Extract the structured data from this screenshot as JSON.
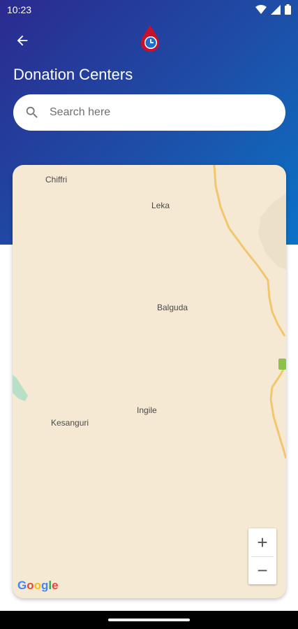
{
  "status_bar": {
    "time": "10:23"
  },
  "header": {
    "title": "Donation Centers",
    "back_icon": "arrow-left-icon",
    "logo_icon": "blood-drop-clock-logo"
  },
  "search": {
    "placeholder": "Search here",
    "value": ""
  },
  "map": {
    "places": [
      "Chiffri",
      "Leka",
      "Balguda",
      "Ingile",
      "Kesanguri"
    ],
    "zoom_in_label": "+",
    "zoom_out_label": "−",
    "attribution": "Google",
    "colors": {
      "land": "#f6e9d3",
      "road": "#f2c66d",
      "park": "#b8e0c6",
      "terrain": "#ede0c8"
    }
  },
  "colors": {
    "header_start": "#2b2a8f",
    "header_end": "#0b73c6",
    "accent_red": "#c8102e"
  }
}
